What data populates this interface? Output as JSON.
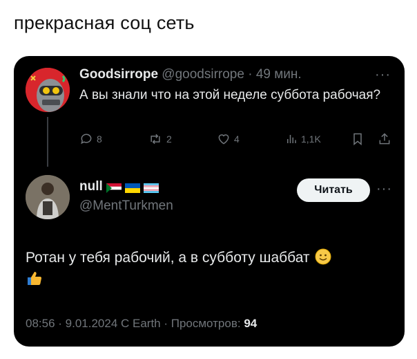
{
  "caption": "прекрасная соц сеть",
  "quoted_post": {
    "author_name": "Goodsirrope",
    "author_handle": "@goodsirrope",
    "time_ago": "· 49 мин.",
    "text": "А вы знали что на этой неделе суббота рабочая?",
    "more_icon": "···",
    "stats": {
      "replies": "8",
      "reposts": "2",
      "likes": "4",
      "views": "1,1K"
    }
  },
  "reply_post": {
    "author_name": "null",
    "author_handle": "@MentTurkmen",
    "follow_label": "Читать",
    "more_icon": "···",
    "text": "Ротан у тебя рабочий, а в субботу шаббат",
    "meta_prefix": "08:56 · 9.01.2024 С Earth · Просмотров: ",
    "views_count": "94"
  },
  "colors": {
    "background": "#000000",
    "text": "#e7e9ea",
    "muted": "#71767b",
    "avatar_red": "#d8262c"
  }
}
